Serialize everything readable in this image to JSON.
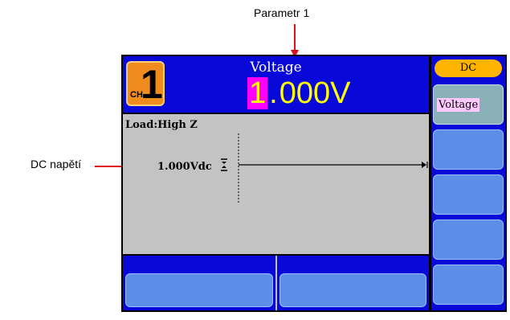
{
  "annotations": {
    "top": "Parametr 1",
    "left": "DC napětí"
  },
  "header": {
    "channel_prefix": "CH",
    "channel_number": "1",
    "param_name": "Voltage",
    "value_cursor_digit": "1",
    "value_separator": ".",
    "value_rest": "000V"
  },
  "plot": {
    "load_label": "Load:High Z",
    "dc_value": "1.000Vdc"
  },
  "side_menu": {
    "title": "DC",
    "items": [
      {
        "label": "Voltage",
        "selected": true
      },
      {
        "label": ""
      },
      {
        "label": ""
      },
      {
        "label": ""
      },
      {
        "label": ""
      }
    ]
  },
  "bottom_menu": {
    "items": [
      {
        "label": ""
      },
      {
        "label": ""
      }
    ]
  },
  "colors": {
    "screen_blue": "#0808d8",
    "value_yellow": "#ffff00",
    "cursor_magenta": "#ff00ff",
    "channel_orange": "#f08c1e",
    "plot_gray": "#c3c3c3",
    "button_blue": "#5c8ee8",
    "annotation_arrow": "#e0101a"
  }
}
